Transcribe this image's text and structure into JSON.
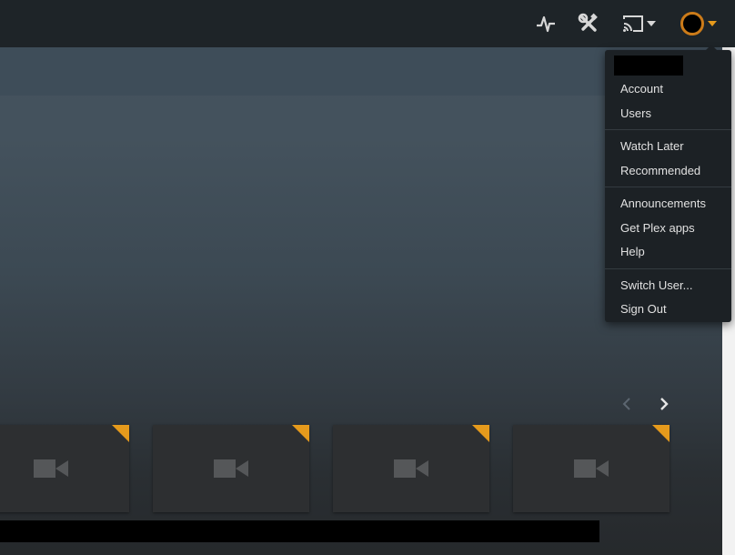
{
  "topbar": {
    "icons": [
      "activity-icon",
      "settings-icon",
      "cast-icon",
      "avatar",
      "caret-down-icon"
    ]
  },
  "user_menu": {
    "items": [
      {
        "label": "Account"
      },
      {
        "label": "Users"
      },
      {
        "label": "Watch Later"
      },
      {
        "label": "Recommended"
      },
      {
        "label": "Announcements"
      },
      {
        "label": "Get Plex apps"
      },
      {
        "label": "Help"
      },
      {
        "label": "Switch User..."
      },
      {
        "label": "Sign Out"
      }
    ]
  },
  "carousel": {
    "cards": [
      {
        "icon": "video-camera-icon"
      },
      {
        "icon": "video-camera-icon"
      },
      {
        "icon": "video-camera-icon"
      },
      {
        "icon": "video-camera-icon"
      }
    ],
    "prev_icon": "chevron-left-icon",
    "next_icon": "chevron-right-icon"
  },
  "colors": {
    "accent": "#e59a1c",
    "topbar": "#1e2428",
    "menu_bg": "#1c2125",
    "menu_text": "#e1e1e1",
    "card_bg": "#2d2f31"
  }
}
